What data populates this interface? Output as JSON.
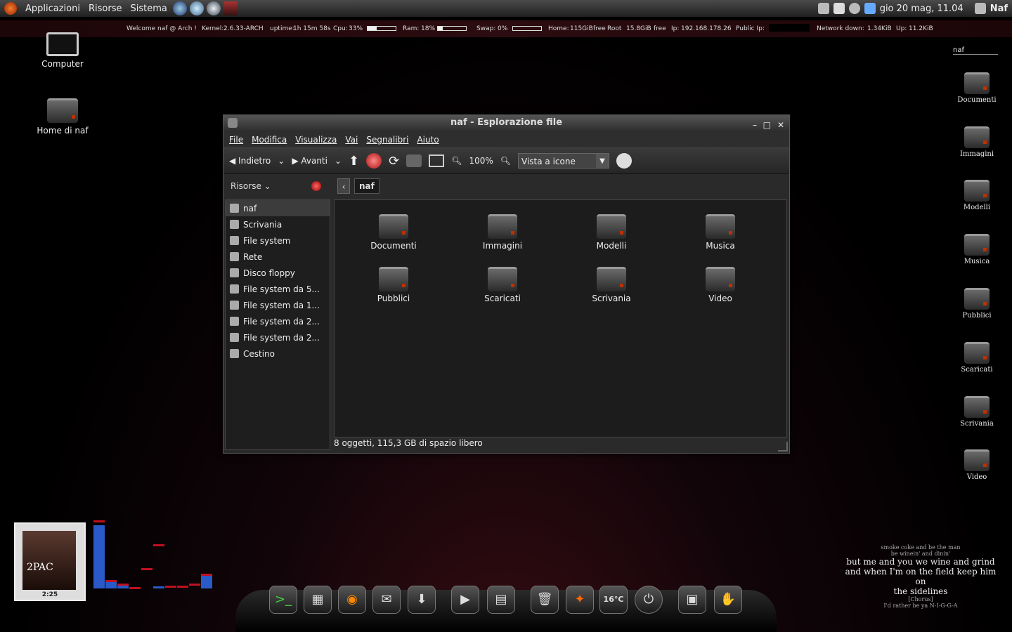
{
  "top_panel": {
    "menus": [
      "Applicazioni",
      "Risorse",
      "Sistema"
    ],
    "clock": "gio 20 mag, 11.04",
    "user": "Naf"
  },
  "conky": {
    "welcome": "Welcome naf @ Arch !",
    "kernel_label": "Kernel:",
    "kernel": "2.6.33-ARCH",
    "uptime_label": "uptime:",
    "uptime": "1h 15m 58s",
    "cpu_label": "Cpu:",
    "cpu": "33%",
    "cpu_fraction": 0.33,
    "ram_label": "Ram:",
    "ram": "18%",
    "ram_fraction": 0.18,
    "swap_label": "Swap:",
    "swap": "0%",
    "swap_fraction": 0.0,
    "home_label": "Home:",
    "home": "115GiB",
    "free1": "free",
    "root_label": "Root",
    "root": "15.8GiB",
    "free2": "free",
    "ip_label": "Ip:",
    "ip": "192.168.178.26",
    "public_ip_label": "Public Ip:",
    "net_down_label": "Network down:",
    "net_down": "1.34KiB",
    "up_label": "Up:",
    "up": "11.2KiB"
  },
  "search_user": "naf",
  "desktop_left": [
    "Computer",
    "Home di naf"
  ],
  "desktop_right": [
    "Documenti",
    "Immagini",
    "Modelli",
    "Musica",
    "Pubblici",
    "Scaricati",
    "Scrivania",
    "Video"
  ],
  "window": {
    "title": "naf - Esplorazione file",
    "menu": [
      "File",
      "Modifica",
      "Visualizza",
      "Vai",
      "Segnalibri",
      "Aiuto"
    ],
    "toolbar": {
      "back": "Indietro",
      "forward": "Avanti",
      "zoom": "100%",
      "view_mode": "Vista a icone"
    },
    "sidebar_header": "Risorse",
    "breadcrumb": "naf",
    "sidebar": [
      "naf",
      "Scrivania",
      "File system",
      "Rete",
      "Disco floppy",
      "File system da 5...",
      "File system da 1...",
      "File system da 2...",
      "File system da 2...",
      "Cestino"
    ],
    "items": [
      "Documenti",
      "Immagini",
      "Modelli",
      "Musica",
      "Pubblici",
      "Scaricati",
      "Scrivania",
      "Video"
    ],
    "status": "8 oggetti, 115,3 GB di spazio libero"
  },
  "music": {
    "time": "2:25",
    "cover_text": "2PAC"
  },
  "lyrics": {
    "pre": [
      "smoke coke and be the man",
      "be winein' and dinin'"
    ],
    "main": [
      "but me and you we wine and grind",
      "and when I'm on the field keep him on",
      "the sidelines"
    ],
    "post": [
      "[Chorus]",
      "I'd rather be ya N-I-G-G-A"
    ]
  },
  "dock": {
    "temperature": "16°C"
  }
}
